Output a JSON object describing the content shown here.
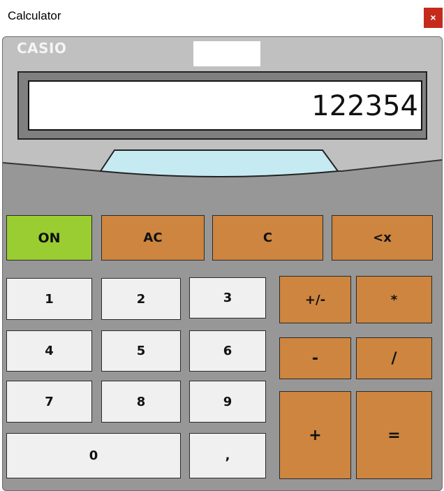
{
  "window": {
    "title": "Calculator",
    "close_label": "×"
  },
  "calculator": {
    "brand": "CASIO",
    "display": "122354"
  },
  "keys": {
    "on": "ON",
    "ac": "AC",
    "c": "C",
    "backspace": "<x",
    "one": "1",
    "two": "2",
    "three": "3",
    "four": "4",
    "five": "5",
    "six": "6",
    "seven": "7",
    "eight": "8",
    "nine": "9",
    "zero": "0",
    "comma": ",",
    "negate": "+/-",
    "multiply": "*",
    "subtract": "-",
    "divide": "/",
    "add": "+",
    "equals": "="
  },
  "colors": {
    "body": "#979797",
    "upper_panel": "#c0c0c0",
    "window_strip": "#c6eaf2",
    "number_key": "#f0f0f0",
    "operator_key": "#cd853f",
    "on_key": "#9acd32",
    "close": "#c42b1c"
  }
}
